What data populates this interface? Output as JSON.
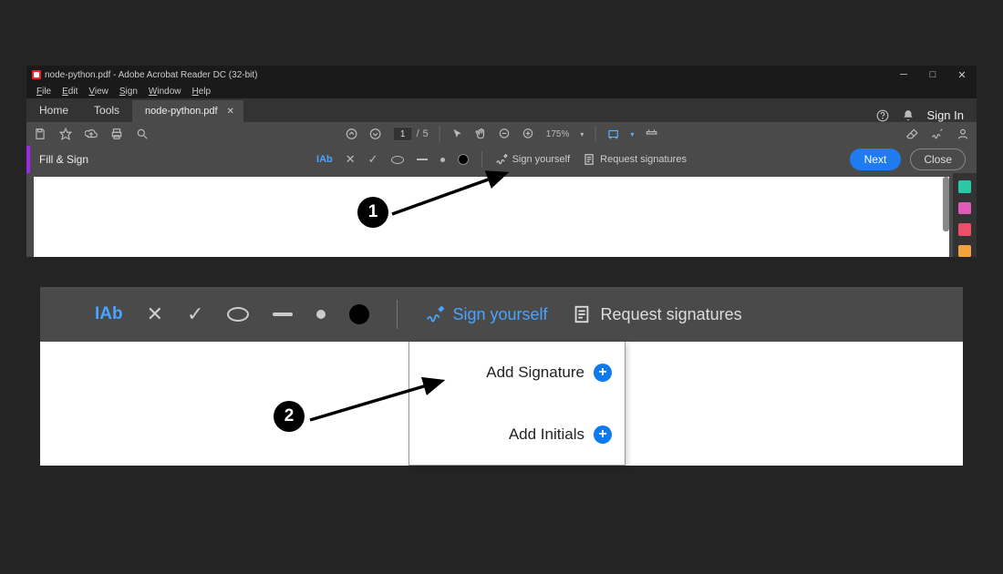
{
  "window": {
    "title": "node-python.pdf - Adobe Acrobat Reader DC (32-bit)"
  },
  "menu": {
    "file": "File",
    "edit": "Edit",
    "view": "View",
    "sign": "Sign",
    "window": "Window",
    "help": "Help"
  },
  "tabs": {
    "home": "Home",
    "tools": "Tools",
    "doc": "node-python.pdf"
  },
  "header": {
    "sign_in": "Sign In"
  },
  "toolbar": {
    "page_current": "1",
    "page_total": "5",
    "zoom": "175%"
  },
  "fillsign": {
    "label": "Fill & Sign",
    "iab": "IAb",
    "sign_yourself": "Sign yourself",
    "request_signatures": "Request signatures",
    "next": "Next",
    "close": "Close"
  },
  "panel2": {
    "iab": "IAb",
    "sign_yourself": "Sign yourself",
    "request_signatures": "Request signatures",
    "dropdown": {
      "add_signature": "Add Signature",
      "add_initials": "Add Initials"
    }
  },
  "callouts": {
    "one": "1",
    "two": "2"
  }
}
